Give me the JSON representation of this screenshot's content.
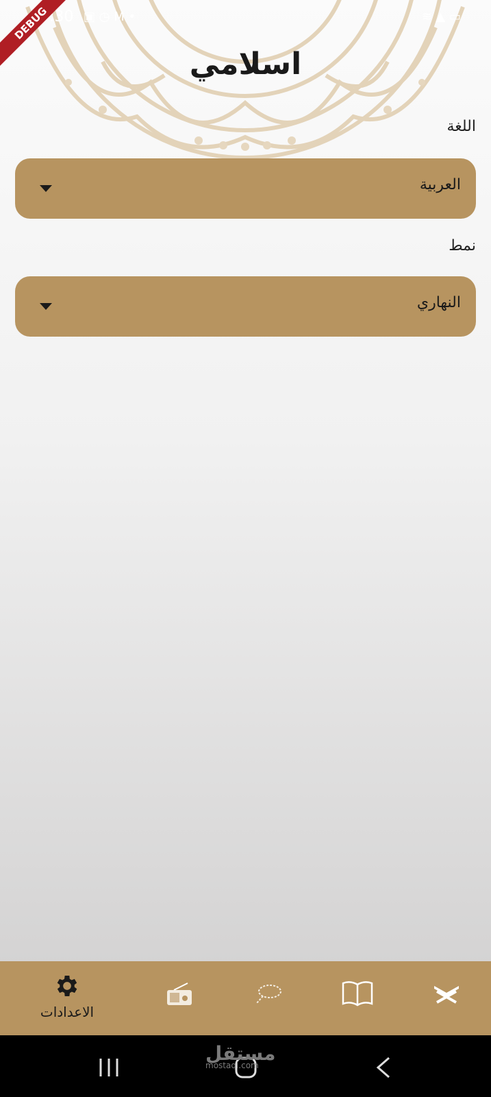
{
  "status_bar": {
    "time": "10:30",
    "left_icons": [
      "gallery-icon",
      "clock-icon",
      "gmail-icon",
      "dot-icon"
    ],
    "right_icons": [
      "wifi-icon",
      "lte-signal-icon",
      "battery-icon"
    ],
    "debug_banner": "DEBUG"
  },
  "header": {
    "title": "اسلامي"
  },
  "settings": {
    "language_label": "اللغة",
    "language_value": "العربية",
    "theme_label": "نمط",
    "theme_value": "النهاري"
  },
  "bottom_nav": {
    "items": [
      {
        "id": "settings",
        "label": "الاعدادات",
        "icon": "gear-icon",
        "active": true
      },
      {
        "id": "radio",
        "label": "",
        "icon": "radio-icon",
        "active": false
      },
      {
        "id": "tasbeeh",
        "label": "",
        "icon": "prayer-beads-icon",
        "active": false
      },
      {
        "id": "hadith",
        "label": "",
        "icon": "open-book-icon",
        "active": false
      },
      {
        "id": "quran",
        "label": "",
        "icon": "quran-stand-icon",
        "active": false
      }
    ]
  },
  "system_nav": [
    "recent-apps-icon",
    "home-icon",
    "back-icon"
  ],
  "watermark": {
    "text": "مستقل",
    "sub": "mostaql.com"
  },
  "colors": {
    "accent": "#b79460",
    "pattern": "#e4d5bd",
    "text": "#1a1a1a"
  }
}
